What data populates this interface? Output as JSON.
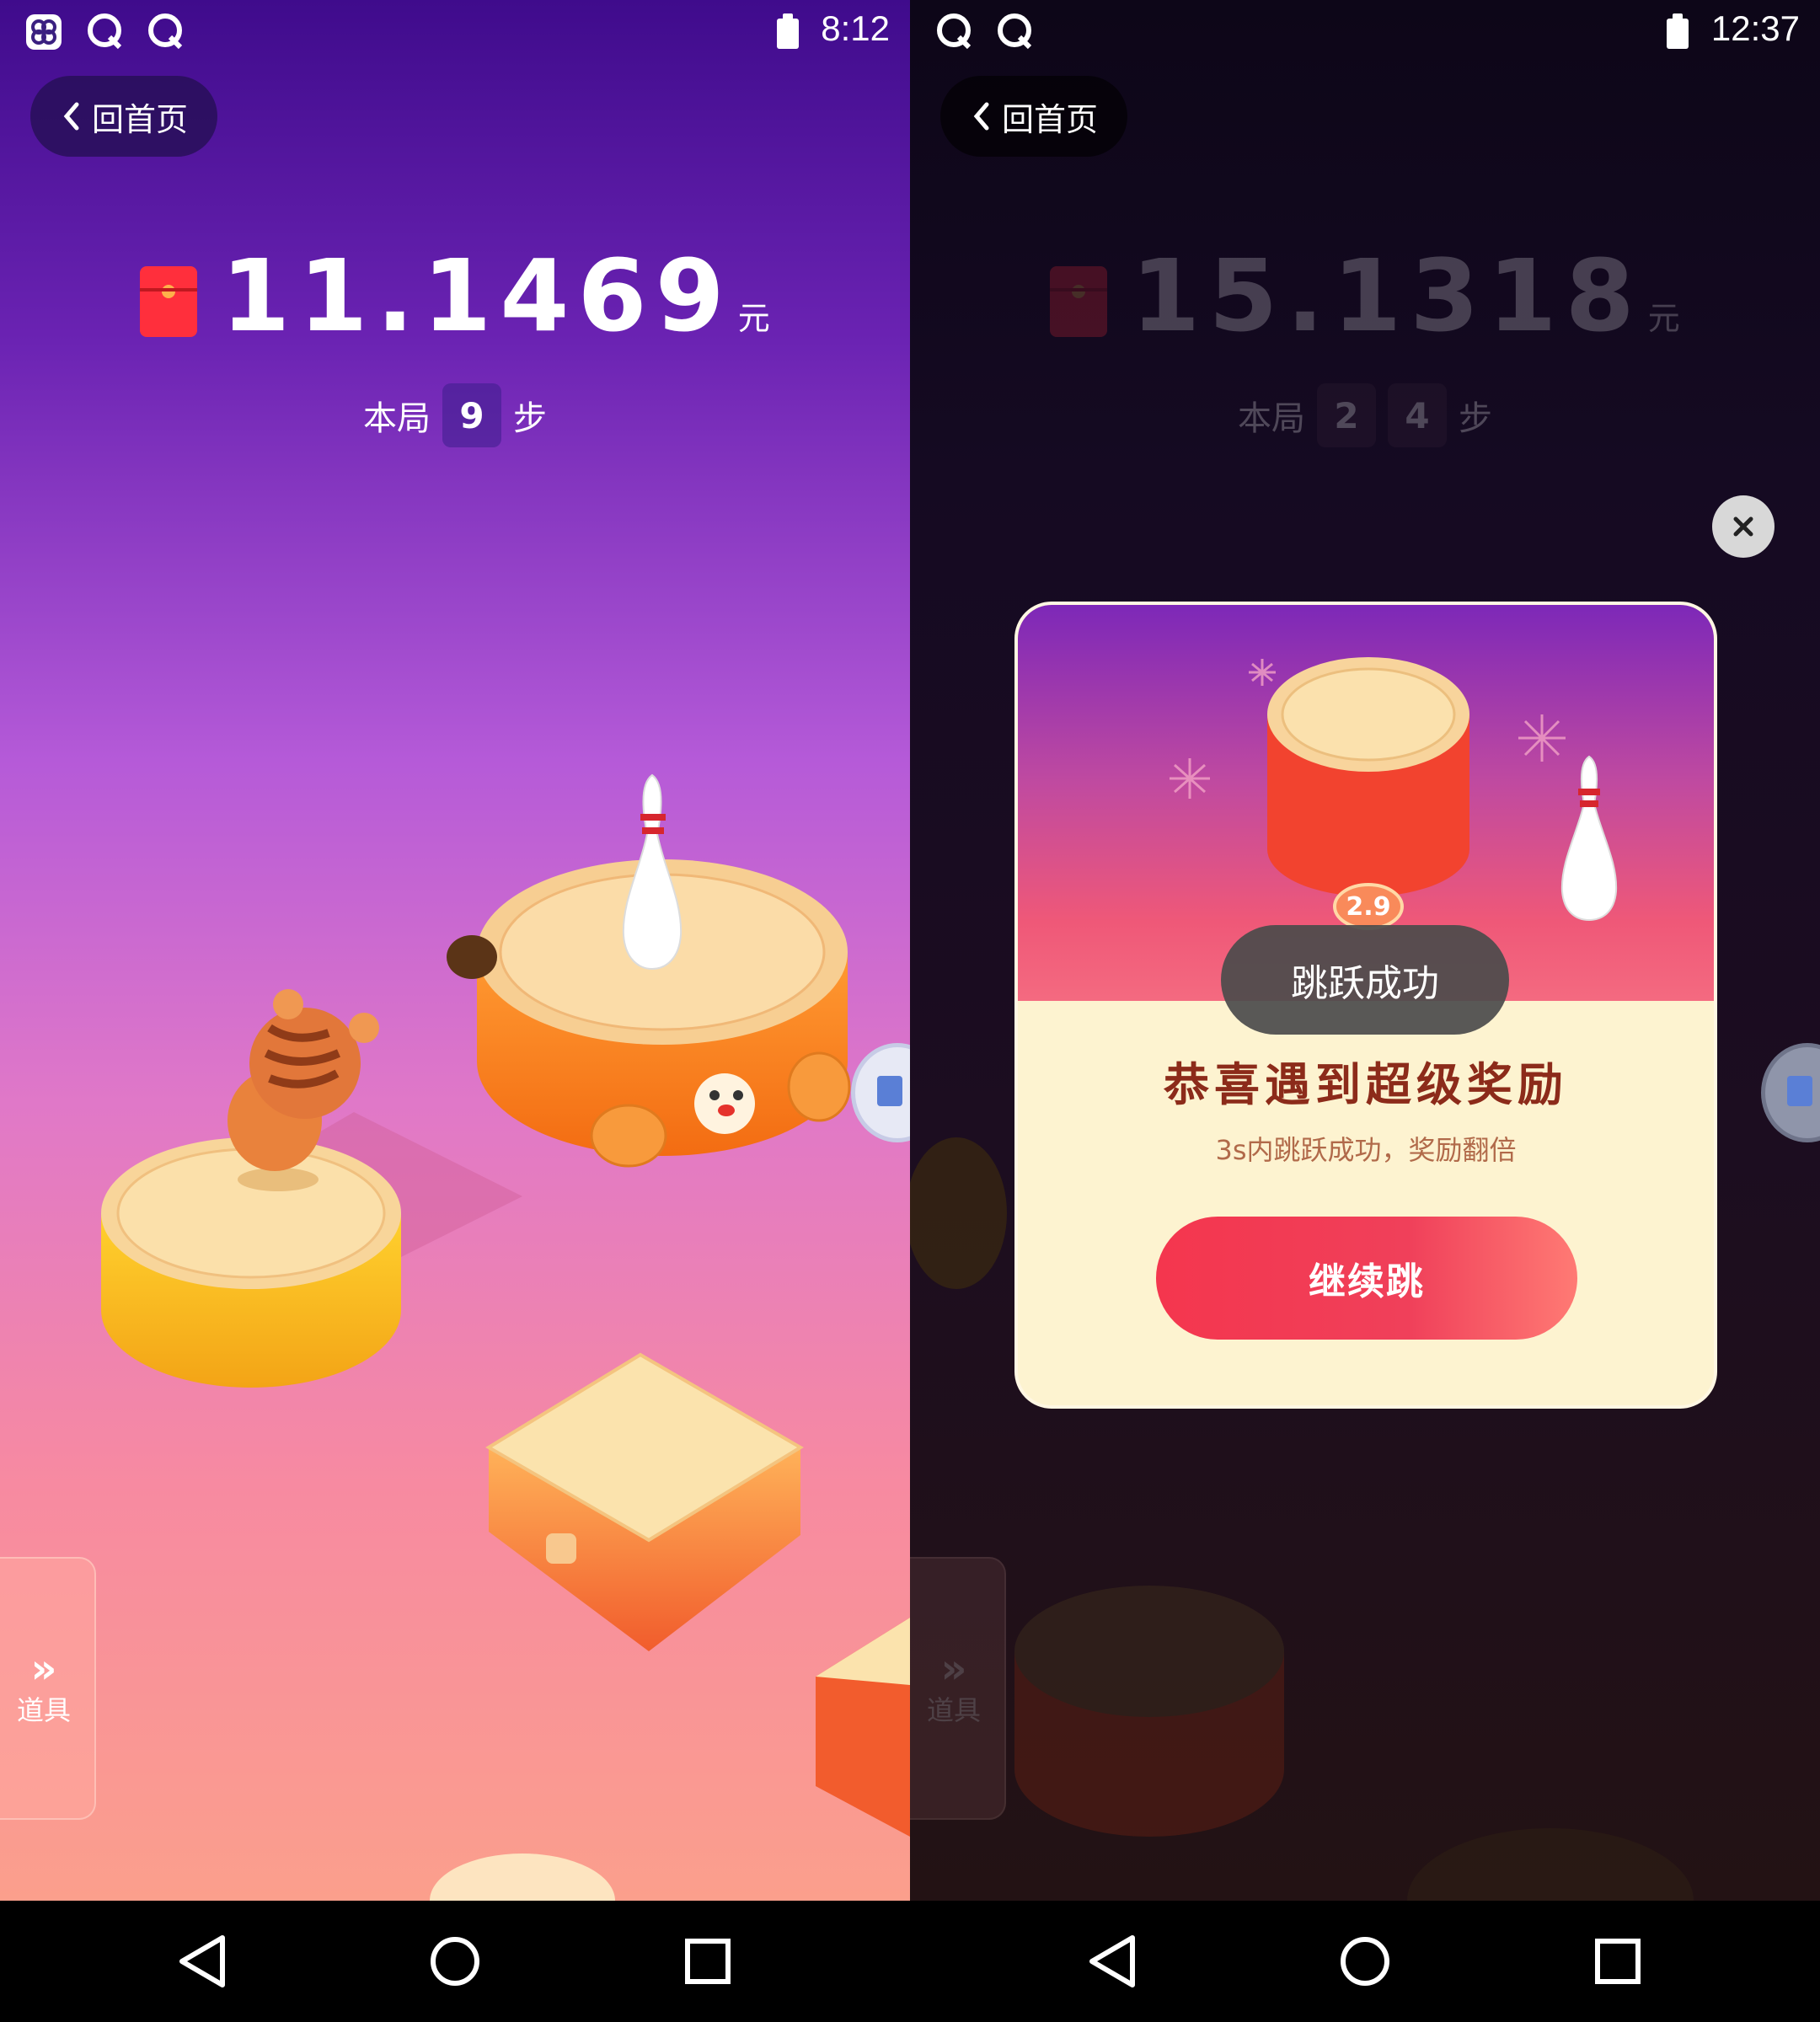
{
  "left": {
    "status": {
      "time": "8:12",
      "icons": [
        "app-icon",
        "qq-icon",
        "qq-icon"
      ]
    },
    "back_label": "回首页",
    "balance": {
      "amount": "11.1469",
      "unit": "元"
    },
    "steps": {
      "prefix": "本局",
      "digits": [
        "9"
      ],
      "suffix": "步"
    },
    "tools_label": "道具"
  },
  "right": {
    "status": {
      "time": "12:37",
      "icons": [
        "qq-icon",
        "qq-icon"
      ]
    },
    "back_label": "回首页",
    "balance": {
      "amount": "15.1318",
      "unit": "元"
    },
    "steps": {
      "prefix": "本局",
      "digits": [
        "2",
        "4"
      ],
      "suffix": "步"
    },
    "tools_label": "道具",
    "dialog": {
      "platform_value": "2.9",
      "title": "恭喜遇到超级奖励",
      "subtitle": "3s内跳跃成功，奖励翻倍",
      "button_label": "继续跳",
      "toast": "跳跃成功"
    }
  },
  "colors": {
    "accent_red": "#f4364e",
    "dialog_bg": "#fdf3d0",
    "title_brown": "#8c2b1a"
  }
}
